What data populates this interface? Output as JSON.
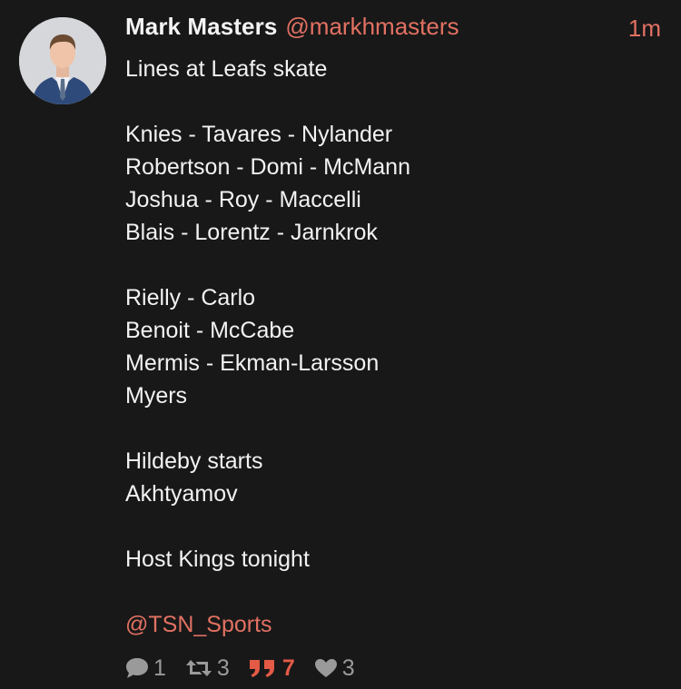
{
  "author": {
    "name": "Mark Masters",
    "handle": "@markhmasters",
    "time": "1m",
    "avatar_icon": "person-avatar"
  },
  "tweet": {
    "lines": [
      "Lines at Leafs skate",
      "",
      "Knies - Tavares - Nylander",
      "Robertson - Domi - McMann",
      "Joshua - Roy - Maccelli",
      "Blais - Lorentz - Jarnkrok",
      "",
      "Rielly - Carlo",
      "Benoit - McCabe",
      "Mermis - Ekman-Larsson",
      "Myers",
      "",
      "Hildeby starts",
      "Akhtyamov",
      "",
      "Host Kings tonight",
      ""
    ],
    "mention": "@TSN_Sports"
  },
  "actions": {
    "replies": "1",
    "retweets": "3",
    "quotes": "7",
    "likes": "3"
  },
  "colors": {
    "background": "#181818",
    "text": "#f2f2f2",
    "accent": "#e27163",
    "quote_active": "#e35a46",
    "muted": "#9a9a9a"
  }
}
